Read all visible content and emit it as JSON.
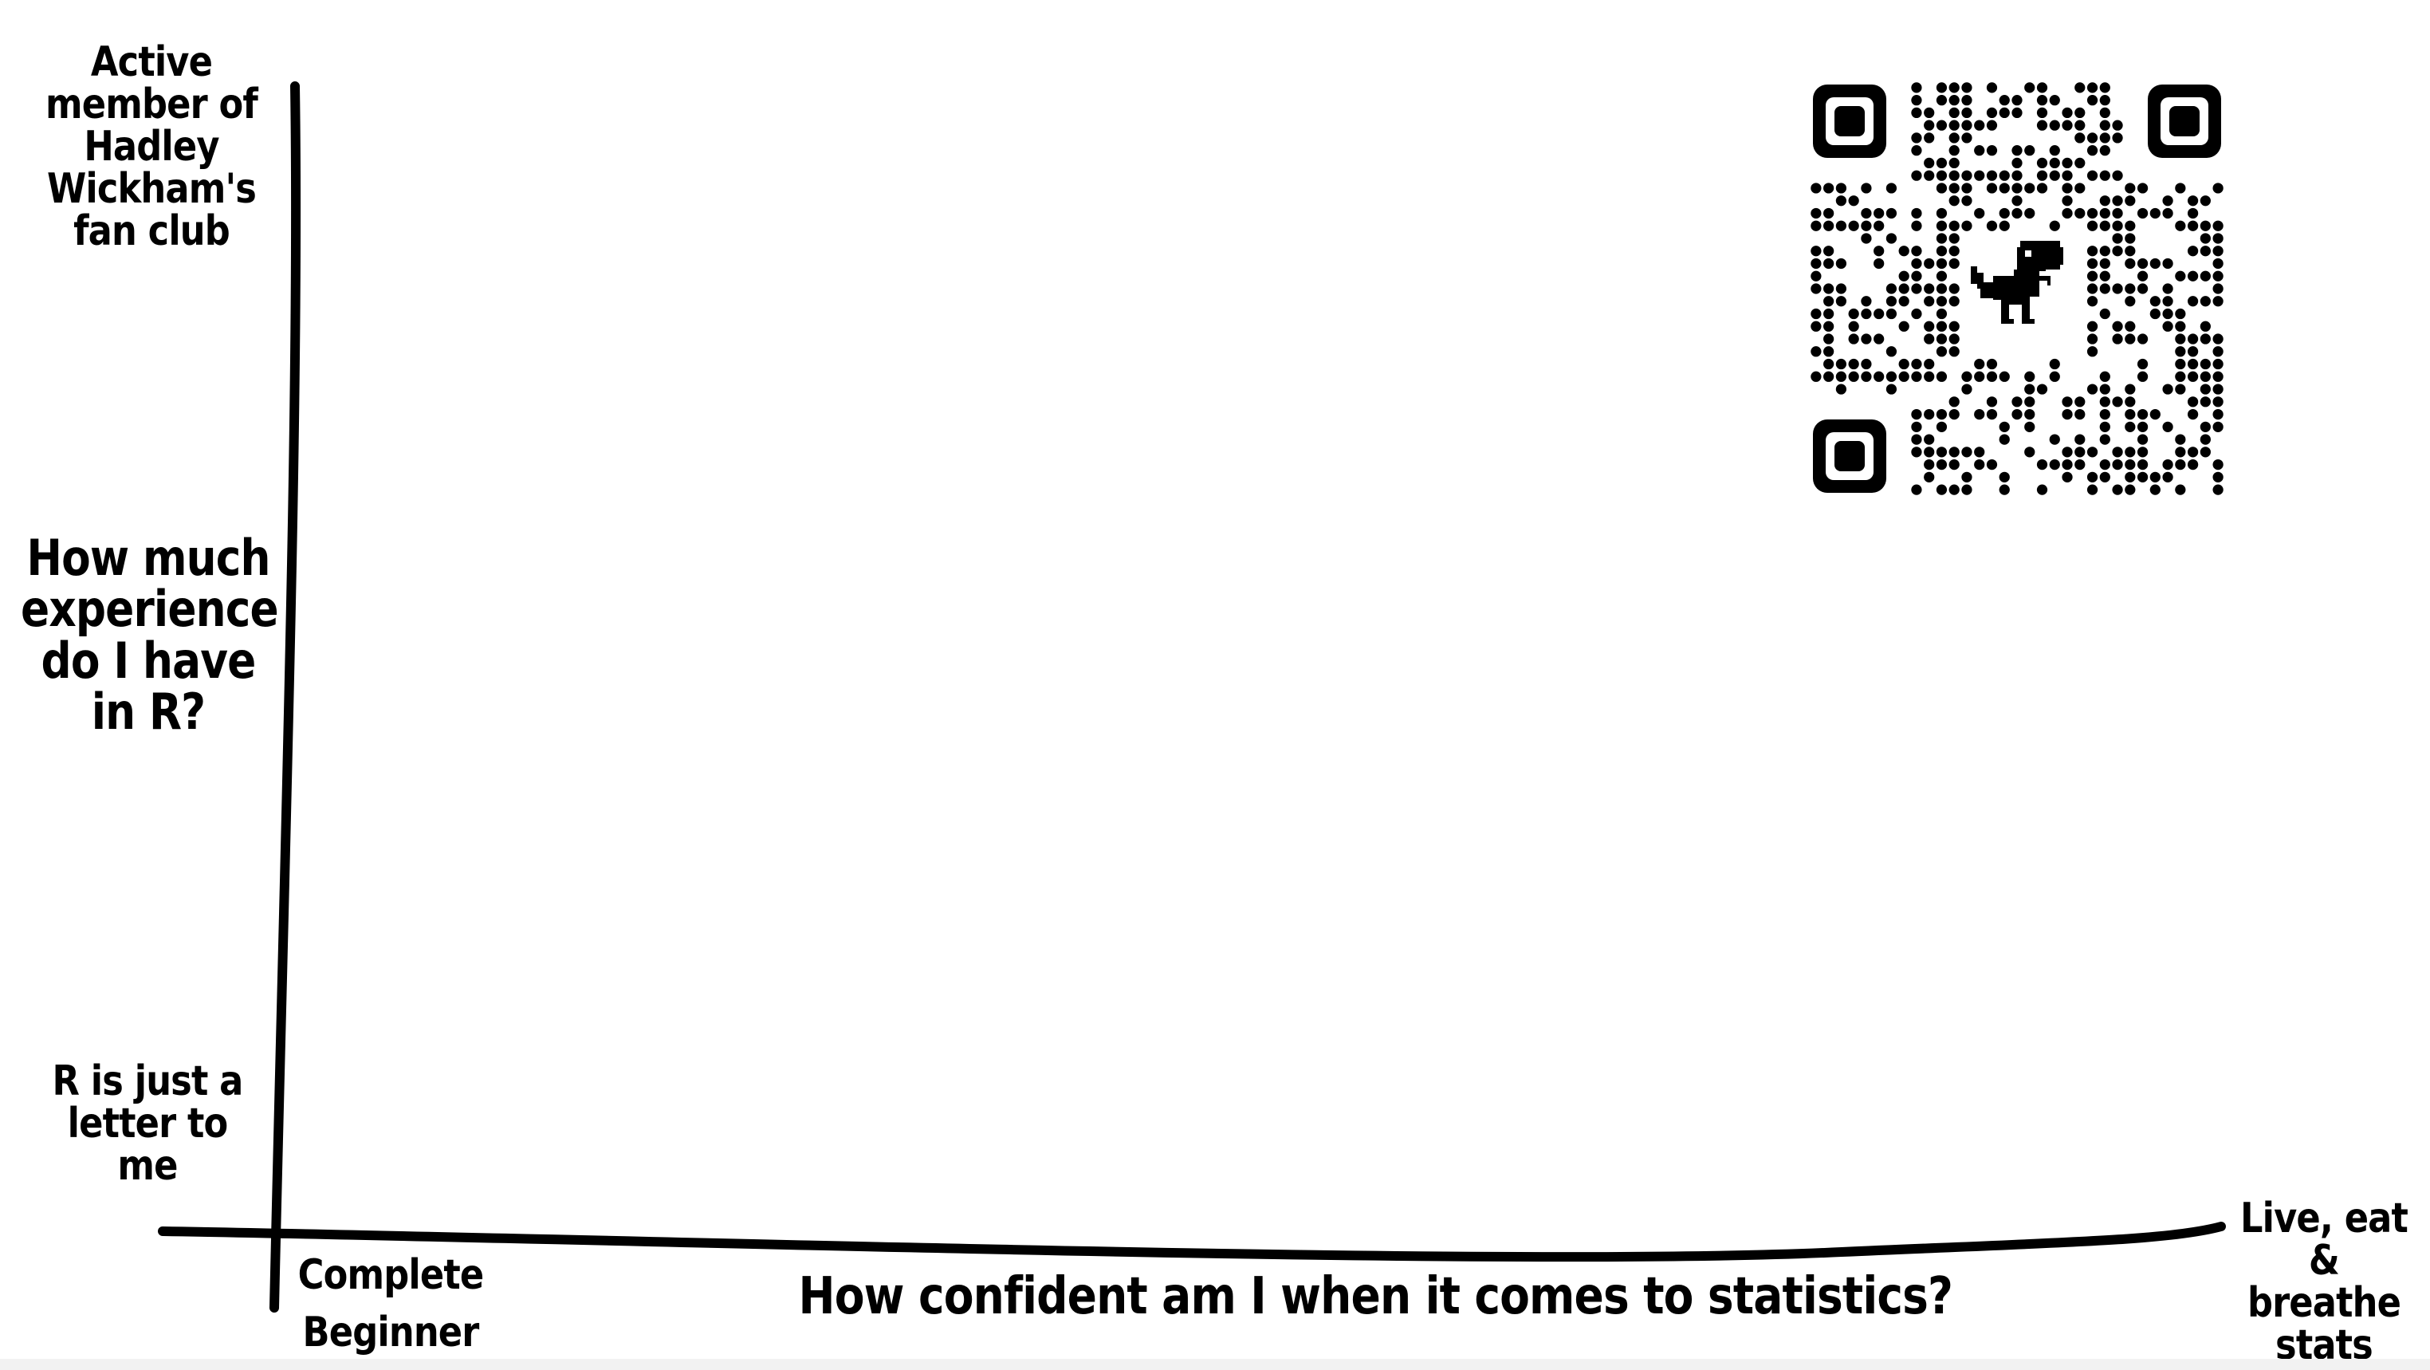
{
  "y_axis": {
    "top_label": "Active member of Hadley Wickham's fan club",
    "title": "How much experience do I have in R?",
    "bottom_label": "R is just a letter to me"
  },
  "x_axis": {
    "left_label": "Complete Beginner",
    "title": "How confident am I when it comes to statistics?",
    "right_label": "Live, eat & breathe stats"
  },
  "qr_code": {
    "icon": "dinosaur-icon"
  }
}
